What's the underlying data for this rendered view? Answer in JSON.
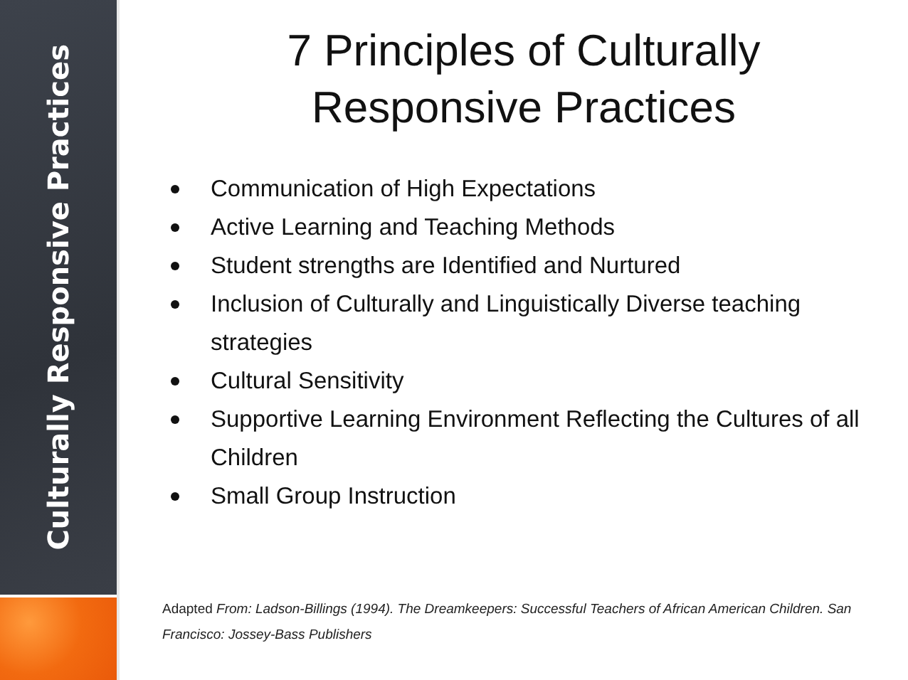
{
  "sidebar": {
    "title": "Culturally Responsive Practices"
  },
  "slide": {
    "title": "7 Principles of Culturally Responsive Practices",
    "bullets": [
      {
        "text": "Communication of High Expectations"
      },
      {
        "text": "Active Learning and Teaching Methods"
      },
      {
        "text": "Student strengths are Identified and Nurtured"
      },
      {
        "text": "Inclusion of Culturally and Linguistically Diverse teaching strategies"
      },
      {
        "text": "Cultural Sensitivity"
      },
      {
        "text": "Supportive Learning Environment Reflecting the Cultures of all Children"
      },
      {
        "text": "Small Group Instruction"
      }
    ],
    "citation": "Adapted *From: Ladson-Billings (1994). The Dreamkeepers: Successful Teachers of African American Children. San Francisco: Jossey-Bass Publishers*"
  }
}
